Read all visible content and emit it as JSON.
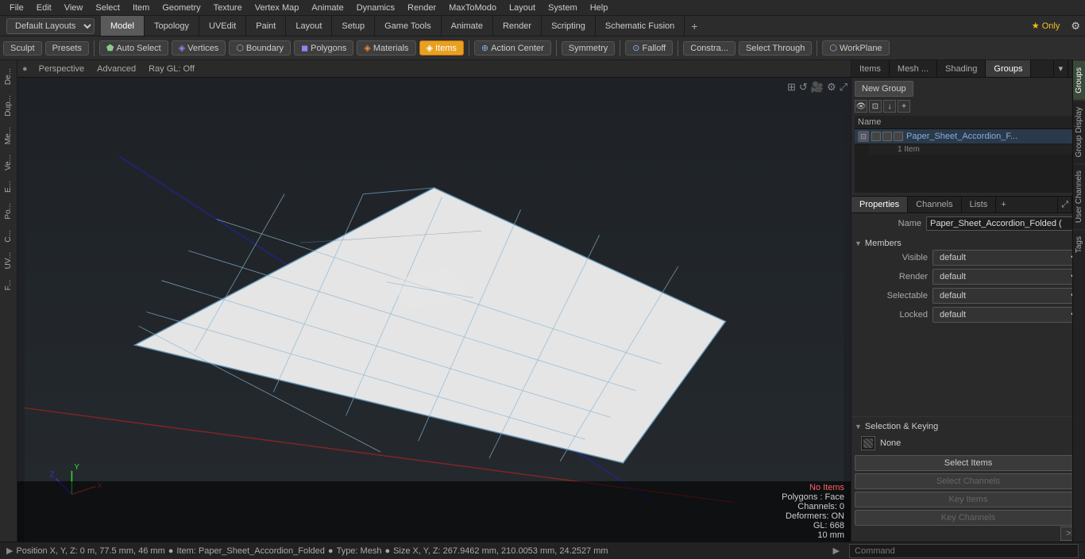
{
  "menu": {
    "items": [
      "File",
      "Edit",
      "View",
      "Select",
      "Item",
      "Geometry",
      "Texture",
      "Vertex Map",
      "Animate",
      "Dynamics",
      "Render",
      "MaxToModo",
      "Layout",
      "System",
      "Help"
    ]
  },
  "layout_bar": {
    "selector_label": "Default Layouts ▾",
    "tabs": [
      "Model",
      "Topology",
      "UVEdit",
      "Paint",
      "Layout",
      "Setup",
      "Game Tools",
      "Animate",
      "Render",
      "Scripting",
      "Schematic Fusion"
    ],
    "active_tab": "Model",
    "plus_label": "+",
    "star_label": "★ Only"
  },
  "toolbar": {
    "sculpt": "Sculpt",
    "presets": "Presets",
    "auto_select": "Auto Select",
    "vertices": "Vertices",
    "boundary": "Boundary",
    "polygons": "Polygons",
    "materials": "Materials",
    "items": "Items",
    "action_center": "Action Center",
    "symmetry": "Symmetry",
    "falloff": "Falloff",
    "constraints": "Constra...",
    "select_through": "Select Through",
    "work_plane": "WorkPlane"
  },
  "left_tools": [
    "De...",
    "Dup...",
    "Me...",
    "Ve...",
    "E...",
    "Po...",
    "C...",
    "UV...",
    "F..."
  ],
  "viewport": {
    "mode": "Perspective",
    "shading": "Advanced",
    "ray_gl": "Ray GL: Off",
    "status": {
      "no_items": "No Items",
      "polygons": "Polygons : Face",
      "channels": "Channels: 0",
      "deformers": "Deformers: ON",
      "gl": "GL: 668",
      "ten_mm": "10 mm"
    }
  },
  "right_panel": {
    "top_tabs": [
      "Items",
      "Mesh ...",
      "Shading",
      "Groups"
    ],
    "active_top_tab": "Groups",
    "new_group_btn": "New Group",
    "groups_header": "Name",
    "group_item": {
      "name": "Paper_Sheet_Accordion_F...",
      "sub": "1 Item"
    },
    "props_tabs": [
      "Properties",
      "Channels",
      "Lists"
    ],
    "active_props_tab": "Properties",
    "name_label": "Name",
    "name_value": "Paper_Sheet_Accordion_Folded (",
    "members_label": "Members",
    "visible_label": "Visible",
    "visible_value": "default",
    "render_label": "Render",
    "render_value": "default",
    "selectable_label": "Selectable",
    "selectable_value": "default",
    "locked_label": "Locked",
    "locked_value": "default",
    "sel_keying_label": "Selection & Keying",
    "none_label": "None",
    "select_items_btn": "Select Items",
    "select_channels_btn": "Select Channels",
    "key_items_btn": "Key Items",
    "key_channels_btn": "Key Channels"
  },
  "right_vert_tabs": [
    "Groups",
    "Group Display",
    "User Channels",
    "Tags"
  ],
  "status_bar": {
    "arrow": "▶",
    "position": "Position X, Y, Z:  0 m, 77.5 mm, 46 mm",
    "item_dot": "●",
    "item": "Item:  Paper_Sheet_Accordion_Folded",
    "item_dot2": "●",
    "type": "Type: Mesh",
    "size_dot": "●",
    "size": "Size X, Y, Z:   267.9462 mm, 210.0053 mm, 24.2527 mm",
    "command_placeholder": "Command"
  }
}
